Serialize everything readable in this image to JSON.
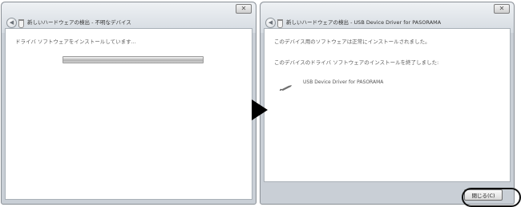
{
  "left_window": {
    "close_glyph": "✕",
    "back_glyph": "◀",
    "title": "新しいハードウェアの検出 - 不明なデバイス",
    "message": "ドライバ ソフトウェアをインストールしています...",
    "progress_fraction": 1.0
  },
  "right_window": {
    "close_glyph": "✕",
    "back_glyph": "◀",
    "title": "新しいハードウェアの検出 - USB Device Driver for PASORAMA",
    "message_1": "このデバイス用のソフトウェアは正常にインストールされました。",
    "message_2": "このデバイスのドライバ ソフトウェアのインストールを終了しました:",
    "device_name": "USB Device Driver for PASORAMA",
    "close_button_label": "閉じる(C)"
  },
  "arrow_icon": "right-arrow-triangle",
  "colors": {
    "window_frame": "#c9cfd6",
    "highlight_ring": "#111111"
  }
}
